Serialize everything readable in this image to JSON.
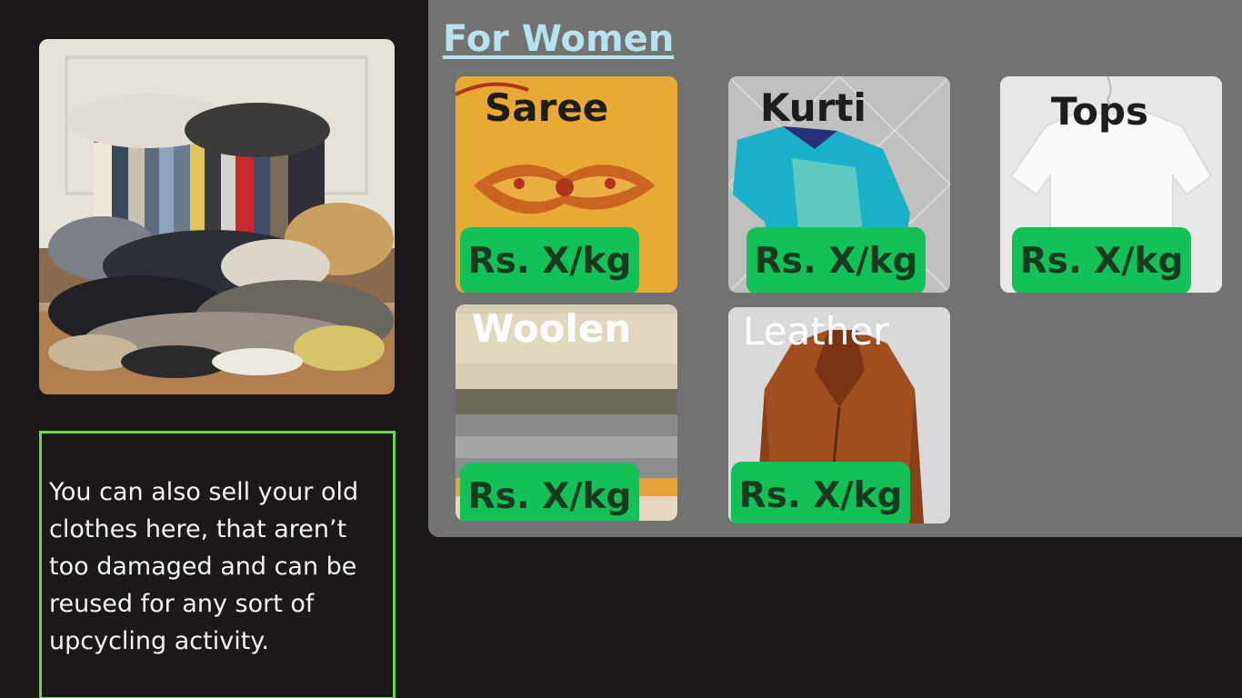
{
  "section": {
    "title": "For Women"
  },
  "info": {
    "text": "You can also sell your old clothes here, that aren’t too damaged and can be reused for any sort of upcycling activity."
  },
  "products": [
    {
      "name": "Saree",
      "price": "Rs. X/kg"
    },
    {
      "name": "Kurti",
      "price": "Rs. X/kg"
    },
    {
      "name": "Tops",
      "price": "Rs. X/kg"
    },
    {
      "name": "Woolen",
      "price": "Rs. X/kg"
    },
    {
      "name": "Leather",
      "price": "Rs. X/kg"
    }
  ],
  "colors": {
    "background": "#1c1819",
    "panel": "#727272",
    "title": "#b7e3ef",
    "price_badge": "#12c259",
    "price_text": "#193a1e",
    "info_border": "#6fd352"
  }
}
